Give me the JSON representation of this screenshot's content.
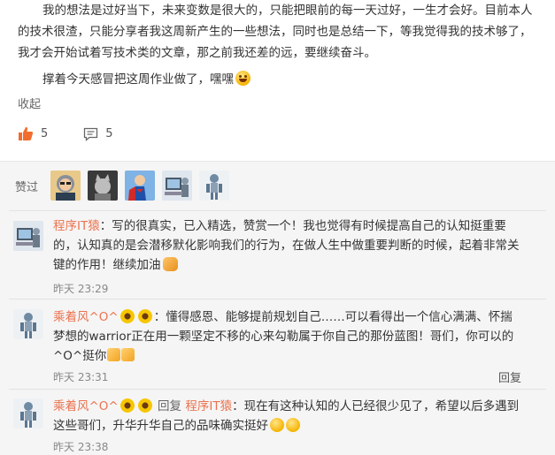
{
  "post": {
    "para1": "我的想法是过好当下，未来变数是很大的，只能把眼前的每一天过好，一生才会好。目前本人的技术很渣，只能分享者我这周新产生的一些想法，同时也是总结一下，等我觉得我的技术够了，我才会开始试着写技术类的文章，那之前我还差的远，要继续奋斗。",
    "para2": "撑着今天感冒把这周作业做了，嘿嘿",
    "fold_label": "收起",
    "like_count": "5",
    "comment_count": "5"
  },
  "likes": {
    "label": "赞过"
  },
  "comments": [
    {
      "user": "程序IT猿",
      "sep": "：",
      "text": "写的很真实，已入精选，赞赏一个！我也觉得有时候提高自己的认知挺重要的，认知真的是会潜移默化影响我们的行为，在做人生中做重要判断的时候，起着非常关键的作用！继续加油",
      "time": "昨天 23:29"
    },
    {
      "user": "乘着风^O^",
      "sep": "：",
      "text": "懂得感恩、能够提前规划自己……可以看得出一个信心满满、怀揣梦想的warrior正在用一颗坚定不移的心来勾勒属于你自己的那份蓝图！哥们，你可以的^O^挺你",
      "time": "昨天 23:31",
      "reply_label": "回复"
    },
    {
      "user": "乘着风^O^",
      "reply_word": "回复",
      "reply_to": "程序IT猿",
      "sep": "：",
      "text": "现在有这种认知的人已经很少见了，希望以后多遇到这些哥们，升华升华自己的品味确实挺好",
      "time": "昨天 23:38"
    }
  ],
  "colors": {
    "username": "#eb7350",
    "section_bg": "#f5f5f5",
    "like_icon": "#f26d2d"
  }
}
